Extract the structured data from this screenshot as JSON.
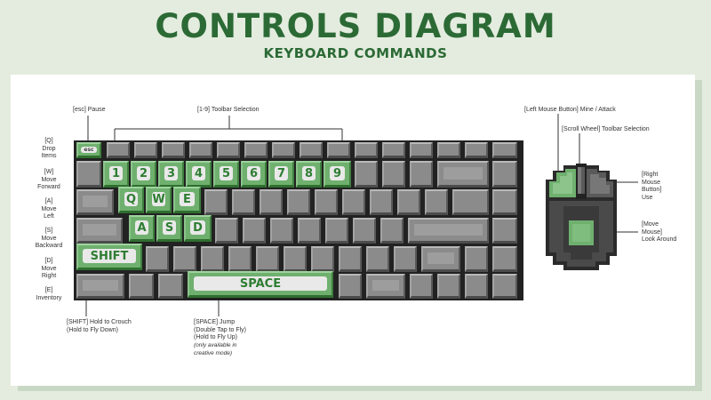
{
  "header": {
    "title": "CONTROLS DIAGRAM",
    "subtitle": "KEYBOARD COMMANDS"
  },
  "labels": {
    "esc": "[esc] Pause",
    "toolbar": "[1-9] Toolbar Selection",
    "q": "[Q]\nDrop\nItems",
    "w": "[W]\nMove\nForward",
    "a": "[A]\nMove\nLeft",
    "s": "[S]\nMove\nBackward",
    "d": "[D]\nMove\nRight",
    "e": "[E]\nInventory",
    "shift": "[SHIFT] Hold to Crouch\n(Hold to Fly Down)",
    "space": "[SPACE] Jump\n(Double Tap to Fly)\n(Hold to Fly Up)",
    "space_note": "(only available in\ncreative mode)",
    "left_mouse": "[Left Mouse Button] Mine / Attack",
    "scroll": "[Scroll Wheel] Toolbar Selection",
    "right_mouse": "[Right\nMouse\nButton]\nUse",
    "move_mouse": "[Move\nMouse]\nLook Around"
  },
  "keys": {
    "esc": "esc",
    "numbers": [
      "1",
      "2",
      "3",
      "4",
      "5",
      "6",
      "7",
      "8",
      "9"
    ],
    "q": "Q",
    "w": "W",
    "e": "E",
    "a": "A",
    "s": "S",
    "d": "D",
    "shift": "SHIFT",
    "space": "SPACE"
  },
  "colors": {
    "title": "#2c6a35",
    "background": "#e3ecdf",
    "highlight_key": "#6fb06f",
    "key": "#8b8b8b",
    "keyboard_frame": "#222222"
  }
}
